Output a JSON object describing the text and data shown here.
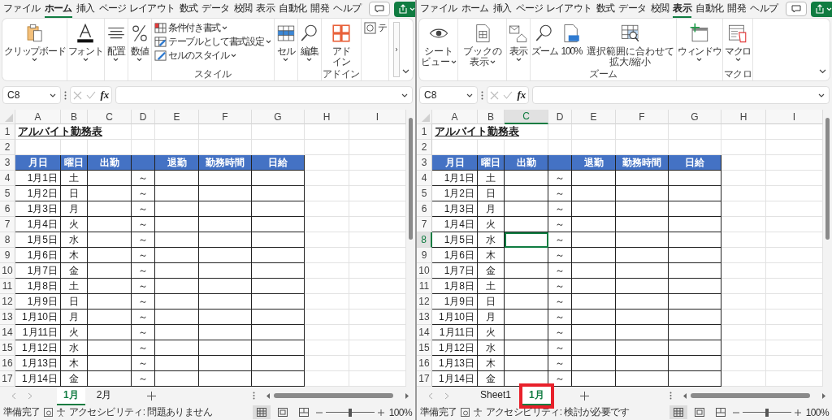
{
  "windows": [
    {
      "menu": [
        {
          "label": "ファイル",
          "selected": false
        },
        {
          "label": "ホーム",
          "selected": true
        },
        {
          "label": "挿入",
          "selected": false
        },
        {
          "label": "ページ レイアウト",
          "selected": false
        },
        {
          "label": "数式",
          "selected": false
        },
        {
          "label": "データ",
          "selected": false
        },
        {
          "label": "校閲",
          "selected": false
        },
        {
          "label": "表示",
          "selected": false
        },
        {
          "label": "自動化",
          "selected": false
        },
        {
          "label": "開発",
          "selected": false
        },
        {
          "label": "ヘルプ",
          "selected": false
        }
      ],
      "ribbon": {
        "overflow": true,
        "groups": [
          {
            "items": [
              {
                "kind": "large",
                "label": "クリップボード",
                "caret": true
              }
            ]
          },
          {
            "items": [
              {
                "kind": "large",
                "label": "フォント",
                "caret": true
              }
            ]
          },
          {
            "items": [
              {
                "kind": "large",
                "label": "配置",
                "caret": true
              }
            ]
          },
          {
            "items": [
              {
                "kind": "large",
                "label": "数値",
                "caret": true
              }
            ]
          },
          {
            "label": "スタイル",
            "items": [
              {
                "kind": "small",
                "label": "条件付き書式",
                "caret": true
              },
              {
                "kind": "small",
                "label": "テーブルとして書式設定",
                "caret": true
              },
              {
                "kind": "small",
                "label": "セルのスタイル",
                "caret": true
              }
            ]
          },
          {
            "items": [
              {
                "kind": "large",
                "label": "セル",
                "caret": true
              }
            ]
          },
          {
            "items": [
              {
                "kind": "large",
                "label": "編集",
                "caret": true
              }
            ]
          },
          {
            "label": "アドイン",
            "items": [
              {
                "kind": "large",
                "label": "アドイン"
              }
            ]
          },
          {
            "items": [
              {
                "kind": "small",
                "label": "テ"
              }
            ]
          }
        ]
      },
      "formula_bar": {
        "name_box": "C8",
        "function_label": "fx"
      },
      "sheet": {
        "columns": [
          {
            "label": "A",
            "selected": false
          },
          {
            "label": "B",
            "selected": false
          },
          {
            "label": "C",
            "selected": false
          },
          {
            "label": "D",
            "selected": false
          },
          {
            "label": "E",
            "selected": false
          },
          {
            "label": "F",
            "selected": false
          },
          {
            "label": "G",
            "selected": false
          },
          {
            "label": "H",
            "selected": false
          },
          {
            "label": "I",
            "selected": false
          }
        ],
        "rows": [
          {
            "number": "1",
            "kind": "title",
            "selected": false,
            "cells": {
              "date": "アルバイト勤務表"
            }
          },
          {
            "number": "2",
            "kind": "blank",
            "selected": false
          },
          {
            "number": "3",
            "kind": "header",
            "selected": false,
            "cells": {
              "date": "月日",
              "weekday": "曜日",
              "start": "出勤",
              "end": "退勤",
              "hours": "勤務時間",
              "pay": "日給"
            }
          },
          {
            "number": "4",
            "kind": "data",
            "selected": false,
            "cells": {
              "date": "1月1日",
              "weekday": "土",
              "separator": "～"
            }
          },
          {
            "number": "5",
            "kind": "data",
            "selected": false,
            "cells": {
              "date": "1月2日",
              "weekday": "日",
              "separator": "～"
            }
          },
          {
            "number": "6",
            "kind": "data",
            "selected": false,
            "cells": {
              "date": "1月3日",
              "weekday": "月",
              "separator": "～"
            }
          },
          {
            "number": "7",
            "kind": "data",
            "selected": false,
            "cells": {
              "date": "1月4日",
              "weekday": "火",
              "separator": "～"
            }
          },
          {
            "number": "8",
            "kind": "data",
            "selected": false,
            "cells": {
              "date": "1月5日",
              "weekday": "水",
              "separator": "～"
            }
          },
          {
            "number": "9",
            "kind": "data",
            "selected": false,
            "cells": {
              "date": "1月6日",
              "weekday": "木",
              "separator": "～"
            }
          },
          {
            "number": "10",
            "kind": "data",
            "selected": false,
            "cells": {
              "date": "1月7日",
              "weekday": "金",
              "separator": "～"
            }
          },
          {
            "number": "11",
            "kind": "data",
            "selected": false,
            "cells": {
              "date": "1月8日",
              "weekday": "土",
              "separator": "～"
            }
          },
          {
            "number": "12",
            "kind": "data",
            "selected": false,
            "cells": {
              "date": "1月9日",
              "weekday": "日",
              "separator": "～"
            }
          },
          {
            "number": "13",
            "kind": "data",
            "selected": false,
            "cells": {
              "date": "1月10日",
              "weekday": "月",
              "separator": "～"
            }
          },
          {
            "number": "14",
            "kind": "data",
            "selected": false,
            "cells": {
              "date": "1月11日",
              "weekday": "火",
              "separator": "～"
            }
          },
          {
            "number": "15",
            "kind": "data",
            "selected": false,
            "cells": {
              "date": "1月12日",
              "weekday": "水",
              "separator": "～"
            }
          },
          {
            "number": "16",
            "kind": "data",
            "selected": false,
            "cells": {
              "date": "1月13日",
              "weekday": "木",
              "separator": "～"
            }
          },
          {
            "number": "17",
            "kind": "data",
            "selected": false,
            "cells": {
              "date": "1月14日",
              "weekday": "金",
              "separator": "～"
            }
          }
        ]
      },
      "sheet_tabs": [
        {
          "label": "1月",
          "selected": true,
          "highlighted": false
        },
        {
          "label": "2月",
          "selected": false,
          "highlighted": false
        }
      ],
      "status_bar": {
        "ready": "準備完了",
        "accessibility": "アクセシビリティ: 問題ありません",
        "views": [
          {
            "selected": true
          },
          {
            "selected": false
          },
          {
            "selected": false
          }
        ],
        "zoom_slider": {
          "level": 0.5
        },
        "zoom": "100%"
      }
    },
    {
      "menu": [
        {
          "label": "ファイル",
          "selected": false
        },
        {
          "label": "ホーム",
          "selected": false
        },
        {
          "label": "挿入",
          "selected": false
        },
        {
          "label": "ページ レイアウト",
          "selected": false
        },
        {
          "label": "数式",
          "selected": false
        },
        {
          "label": "データ",
          "selected": false
        },
        {
          "label": "校閲",
          "selected": false
        },
        {
          "label": "表示",
          "selected": true
        },
        {
          "label": "自動化",
          "selected": false
        },
        {
          "label": "開発",
          "selected": false
        },
        {
          "label": "ヘルプ",
          "selected": false
        }
      ],
      "ribbon": {
        "groups": [
          {
            "items": [
              {
                "kind": "tall",
                "label": "シートビュー",
                "caret": true
              }
            ]
          },
          {
            "items": [
              {
                "kind": "tall",
                "label": "ブックの表示",
                "caret": true
              }
            ]
          },
          {
            "items": [
              {
                "kind": "large",
                "label": "表示",
                "caret": true
              }
            ]
          },
          {
            "label": "ズーム",
            "items": [
              {
                "kind": "large",
                "label": "ズーム"
              },
              {
                "kind": "large",
                "label": "100%"
              },
              {
                "kind": "tall",
                "label": "選択範囲に合わせて拡大/縮小"
              }
            ]
          },
          {
            "items": [
              {
                "kind": "large",
                "label": "ウィンドウ",
                "caret": true
              }
            ]
          },
          {
            "label": "マクロ",
            "items": [
              {
                "kind": "large",
                "label": "マクロ",
                "caret": true
              }
            ]
          }
        ]
      },
      "formula_bar": {
        "name_box": "C8",
        "function_label": "fx"
      },
      "sheet": {
        "columns": [
          {
            "label": "A",
            "selected": false
          },
          {
            "label": "B",
            "selected": false
          },
          {
            "label": "C",
            "selected": true
          },
          {
            "label": "D",
            "selected": false
          },
          {
            "label": "E",
            "selected": false
          },
          {
            "label": "F",
            "selected": false
          },
          {
            "label": "G",
            "selected": false
          },
          {
            "label": "H",
            "selected": false
          },
          {
            "label": "I",
            "selected": false
          }
        ],
        "rows": [
          {
            "number": "1",
            "kind": "title",
            "selected": false,
            "cells": {
              "date": "アルバイト勤務表"
            }
          },
          {
            "number": "2",
            "kind": "blank",
            "selected": false
          },
          {
            "number": "3",
            "kind": "header",
            "selected": false,
            "cells": {
              "date": "月日",
              "weekday": "曜日",
              "start": "出勤",
              "end": "退勤",
              "hours": "勤務時間",
              "pay": "日給"
            }
          },
          {
            "number": "4",
            "kind": "data",
            "selected": false,
            "cells": {
              "date": "1月1日",
              "weekday": "土",
              "separator": "～"
            }
          },
          {
            "number": "5",
            "kind": "data",
            "selected": false,
            "cells": {
              "date": "1月2日",
              "weekday": "日",
              "separator": "～"
            }
          },
          {
            "number": "6",
            "kind": "data",
            "selected": false,
            "cells": {
              "date": "1月3日",
              "weekday": "月",
              "separator": "～"
            }
          },
          {
            "number": "7",
            "kind": "data",
            "selected": false,
            "cells": {
              "date": "1月4日",
              "weekday": "火",
              "separator": "～"
            }
          },
          {
            "number": "8",
            "kind": "data",
            "selected": true,
            "cells": {
              "date": "1月5日",
              "weekday": "水",
              "separator": "～"
            }
          },
          {
            "number": "9",
            "kind": "data",
            "selected": false,
            "cells": {
              "date": "1月6日",
              "weekday": "木",
              "separator": "～"
            }
          },
          {
            "number": "10",
            "kind": "data",
            "selected": false,
            "cells": {
              "date": "1月7日",
              "weekday": "金",
              "separator": "～"
            }
          },
          {
            "number": "11",
            "kind": "data",
            "selected": false,
            "cells": {
              "date": "1月8日",
              "weekday": "土",
              "separator": "～"
            }
          },
          {
            "number": "12",
            "kind": "data",
            "selected": false,
            "cells": {
              "date": "1月9日",
              "weekday": "日",
              "separator": "～"
            }
          },
          {
            "number": "13",
            "kind": "data",
            "selected": false,
            "cells": {
              "date": "1月10日",
              "weekday": "月",
              "separator": "～"
            }
          },
          {
            "number": "14",
            "kind": "data",
            "selected": false,
            "cells": {
              "date": "1月11日",
              "weekday": "火",
              "separator": "～"
            }
          },
          {
            "number": "15",
            "kind": "data",
            "selected": false,
            "cells": {
              "date": "1月12日",
              "weekday": "水",
              "separator": "～"
            }
          },
          {
            "number": "16",
            "kind": "data",
            "selected": false,
            "cells": {
              "date": "1月13日",
              "weekday": "木",
              "separator": "～"
            }
          },
          {
            "number": "17",
            "kind": "data",
            "selected": false,
            "cells": {
              "date": "1月14日",
              "weekday": "金",
              "separator": "～"
            }
          }
        ]
      },
      "sheet_tabs": [
        {
          "label": "Sheet1",
          "selected": false,
          "highlighted": false
        },
        {
          "label": "1月",
          "selected": true,
          "highlighted": true
        }
      ],
      "status_bar": {
        "ready": "準備完了",
        "accessibility": "アクセシビリティ: 検討が必要です",
        "views": [
          {
            "selected": true
          },
          {
            "selected": false
          },
          {
            "selected": false
          }
        ],
        "zoom_slider": {
          "level": 0.5
        },
        "zoom": "100%"
      }
    }
  ]
}
